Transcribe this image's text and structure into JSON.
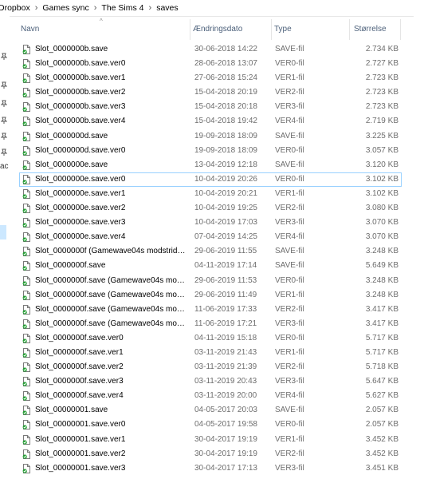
{
  "breadcrumb": [
    "Dropbox",
    "Games sync",
    "The Sims 4",
    "saves"
  ],
  "nav_fragment": "ac",
  "columns": {
    "name": "Navn",
    "date": "Ændringsdato",
    "type": "Type",
    "size": "Størrelse"
  },
  "files": [
    {
      "name": "Slot_0000000b.save",
      "date": "30-06-2018 14:22",
      "type": "SAVE-fil",
      "size": "2.734 KB"
    },
    {
      "name": "Slot_0000000b.save.ver0",
      "date": "28-06-2018 13:07",
      "type": "VER0-fil",
      "size": "2.727 KB"
    },
    {
      "name": "Slot_0000000b.save.ver1",
      "date": "27-06-2018 15:24",
      "type": "VER1-fil",
      "size": "2.723 KB"
    },
    {
      "name": "Slot_0000000b.save.ver2",
      "date": "15-04-2018 20:19",
      "type": "VER2-fil",
      "size": "2.723 KB"
    },
    {
      "name": "Slot_0000000b.save.ver3",
      "date": "15-04-2018 20:18",
      "type": "VER3-fil",
      "size": "2.723 KB"
    },
    {
      "name": "Slot_0000000b.save.ver4",
      "date": "15-04-2018 19:42",
      "type": "VER4-fil",
      "size": "2.719 KB"
    },
    {
      "name": "Slot_0000000d.save",
      "date": "19-09-2018 18:09",
      "type": "SAVE-fil",
      "size": "3.225 KB"
    },
    {
      "name": "Slot_0000000d.save.ver0",
      "date": "19-09-2018 18:09",
      "type": "VER0-fil",
      "size": "3.057 KB"
    },
    {
      "name": "Slot_0000000e.save",
      "date": "13-04-2019 12:18",
      "type": "SAVE-fil",
      "size": "3.120 KB"
    },
    {
      "name": "Slot_0000000e.save.ver0",
      "date": "10-04-2019 20:26",
      "type": "VER0-fil",
      "size": "3.102 KB",
      "selected": true
    },
    {
      "name": "Slot_0000000e.save.ver1",
      "date": "10-04-2019 20:21",
      "type": "VER1-fil",
      "size": "3.102 KB"
    },
    {
      "name": "Slot_0000000e.save.ver2",
      "date": "10-04-2019 19:25",
      "type": "VER2-fil",
      "size": "3.080 KB"
    },
    {
      "name": "Slot_0000000e.save.ver3",
      "date": "10-04-2019 17:03",
      "type": "VER3-fil",
      "size": "3.070 KB"
    },
    {
      "name": "Slot_0000000e.save.ver4",
      "date": "07-04-2019 14:25",
      "type": "VER4-fil",
      "size": "3.070 KB"
    },
    {
      "name": "Slot_0000000f (Gamewave04s modstride...",
      "date": "29-06-2019 11:55",
      "type": "SAVE-fil",
      "size": "3.248 KB"
    },
    {
      "name": "Slot_0000000f.save",
      "date": "04-11-2019 17:14",
      "type": "SAVE-fil",
      "size": "5.649 KB"
    },
    {
      "name": "Slot_0000000f.save (Gamewave04s mods...",
      "date": "29-06-2019 11:53",
      "type": "VER0-fil",
      "size": "3.248 KB"
    },
    {
      "name": "Slot_0000000f.save (Gamewave04s mods...",
      "date": "29-06-2019 11:49",
      "type": "VER1-fil",
      "size": "3.248 KB"
    },
    {
      "name": "Slot_0000000f.save (Gamewave04s mods...",
      "date": "11-06-2019 17:33",
      "type": "VER2-fil",
      "size": "3.417 KB"
    },
    {
      "name": "Slot_0000000f.save (Gamewave04s mods...",
      "date": "11-06-2019 17:21",
      "type": "VER3-fil",
      "size": "3.417 KB"
    },
    {
      "name": "Slot_0000000f.save.ver0",
      "date": "04-11-2019 15:18",
      "type": "VER0-fil",
      "size": "5.717 KB"
    },
    {
      "name": "Slot_0000000f.save.ver1",
      "date": "03-11-2019 21:43",
      "type": "VER1-fil",
      "size": "5.717 KB"
    },
    {
      "name": "Slot_0000000f.save.ver2",
      "date": "03-11-2019 21:39",
      "type": "VER2-fil",
      "size": "5.718 KB"
    },
    {
      "name": "Slot_0000000f.save.ver3",
      "date": "03-11-2019 20:43",
      "type": "VER3-fil",
      "size": "5.647 KB"
    },
    {
      "name": "Slot_0000000f.save.ver4",
      "date": "03-11-2019 20:00",
      "type": "VER4-fil",
      "size": "5.627 KB"
    },
    {
      "name": "Slot_00000001.save",
      "date": "04-05-2017 20:03",
      "type": "SAVE-fil",
      "size": "2.057 KB"
    },
    {
      "name": "Slot_00000001.save.ver0",
      "date": "04-05-2017 19:58",
      "type": "VER0-fil",
      "size": "2.057 KB"
    },
    {
      "name": "Slot_00000001.save.ver1",
      "date": "30-04-2017 19:19",
      "type": "VER1-fil",
      "size": "3.452 KB"
    },
    {
      "name": "Slot_00000001.save.ver2",
      "date": "30-04-2017 19:19",
      "type": "VER2-fil",
      "size": "3.452 KB"
    },
    {
      "name": "Slot_00000001.save.ver3",
      "date": "30-04-2017 17:13",
      "type": "VER3-fil",
      "size": "3.451 KB"
    }
  ]
}
